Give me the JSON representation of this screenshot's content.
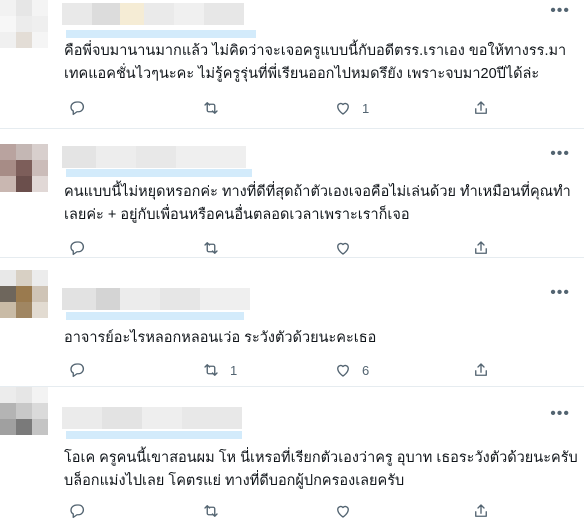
{
  "more_icon": "more-dots-icon",
  "colors": {
    "text": "#0f1419",
    "muted": "#536471",
    "divider": "#e6ecf0",
    "link_blur": "#d3ebfb"
  },
  "replies": [
    {
      "lines": [
        "คือพี่จบมานานมากแล้ว ไม่คิดว่าจะเจอครูแบบนี้กับอดีตรร.เราเอง ขอให้ทางรร.มา",
        "เทคแอคชั่นไวๆนะคะ ไม่รู้ครูรุ่นที่พี่เรียนออกไปหมดรึยัง เพราะจบมา20ปีได้ล่ะ"
      ],
      "actions": {
        "reply": "",
        "retweet": "",
        "like": "1",
        "share": ""
      }
    },
    {
      "lines": [
        "คนแบบนี้ไม่หยุดหรอกค่ะ ทางที่ดีที่สุดถ้าตัวเองเจอคือไม่เล่นด้วย ทำเหมือนที่คุณทำ",
        "เลยค่ะ + อยู่กับเพื่อนหรือคนอื่นตลอดเวลาเพราะเราก็เจอ"
      ],
      "actions": {
        "reply": "",
        "retweet": "",
        "like": "",
        "share": ""
      }
    },
    {
      "lines": [
        "อาจารย์อะไรหลอกหลอนเว่อ ระวังตัวด้วยนะคะเธอ"
      ],
      "actions": {
        "reply": "",
        "retweet": "1",
        "like": "6",
        "share": ""
      }
    },
    {
      "lines": [
        "โอเค ครูคนนี้เขาสอนผม โห นี่เหรอที่เรียกตัวเองว่าครู อุบาท เธอระวังตัวด้วยนะครับ",
        "บล็อกแม่งไปเลย โคตรแย่ ทางที่ดีบอกผู้ปกครองเลยครับ"
      ],
      "actions": {
        "reply": "",
        "retweet": "",
        "like": "",
        "share": ""
      }
    }
  ]
}
